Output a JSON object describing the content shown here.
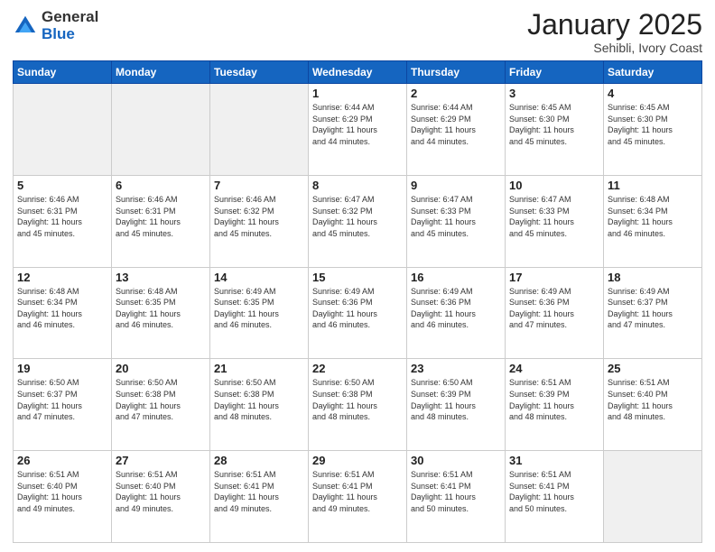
{
  "header": {
    "logo_general": "General",
    "logo_blue": "Blue",
    "month": "January 2025",
    "location": "Sehibli, Ivory Coast"
  },
  "weekdays": [
    "Sunday",
    "Monday",
    "Tuesday",
    "Wednesday",
    "Thursday",
    "Friday",
    "Saturday"
  ],
  "weeks": [
    [
      {
        "day": "",
        "info": ""
      },
      {
        "day": "",
        "info": ""
      },
      {
        "day": "",
        "info": ""
      },
      {
        "day": "1",
        "info": "Sunrise: 6:44 AM\nSunset: 6:29 PM\nDaylight: 11 hours\nand 44 minutes."
      },
      {
        "day": "2",
        "info": "Sunrise: 6:44 AM\nSunset: 6:29 PM\nDaylight: 11 hours\nand 44 minutes."
      },
      {
        "day": "3",
        "info": "Sunrise: 6:45 AM\nSunset: 6:30 PM\nDaylight: 11 hours\nand 45 minutes."
      },
      {
        "day": "4",
        "info": "Sunrise: 6:45 AM\nSunset: 6:30 PM\nDaylight: 11 hours\nand 45 minutes."
      }
    ],
    [
      {
        "day": "5",
        "info": "Sunrise: 6:46 AM\nSunset: 6:31 PM\nDaylight: 11 hours\nand 45 minutes."
      },
      {
        "day": "6",
        "info": "Sunrise: 6:46 AM\nSunset: 6:31 PM\nDaylight: 11 hours\nand 45 minutes."
      },
      {
        "day": "7",
        "info": "Sunrise: 6:46 AM\nSunset: 6:32 PM\nDaylight: 11 hours\nand 45 minutes."
      },
      {
        "day": "8",
        "info": "Sunrise: 6:47 AM\nSunset: 6:32 PM\nDaylight: 11 hours\nand 45 minutes."
      },
      {
        "day": "9",
        "info": "Sunrise: 6:47 AM\nSunset: 6:33 PM\nDaylight: 11 hours\nand 45 minutes."
      },
      {
        "day": "10",
        "info": "Sunrise: 6:47 AM\nSunset: 6:33 PM\nDaylight: 11 hours\nand 45 minutes."
      },
      {
        "day": "11",
        "info": "Sunrise: 6:48 AM\nSunset: 6:34 PM\nDaylight: 11 hours\nand 46 minutes."
      }
    ],
    [
      {
        "day": "12",
        "info": "Sunrise: 6:48 AM\nSunset: 6:34 PM\nDaylight: 11 hours\nand 46 minutes."
      },
      {
        "day": "13",
        "info": "Sunrise: 6:48 AM\nSunset: 6:35 PM\nDaylight: 11 hours\nand 46 minutes."
      },
      {
        "day": "14",
        "info": "Sunrise: 6:49 AM\nSunset: 6:35 PM\nDaylight: 11 hours\nand 46 minutes."
      },
      {
        "day": "15",
        "info": "Sunrise: 6:49 AM\nSunset: 6:36 PM\nDaylight: 11 hours\nand 46 minutes."
      },
      {
        "day": "16",
        "info": "Sunrise: 6:49 AM\nSunset: 6:36 PM\nDaylight: 11 hours\nand 46 minutes."
      },
      {
        "day": "17",
        "info": "Sunrise: 6:49 AM\nSunset: 6:36 PM\nDaylight: 11 hours\nand 47 minutes."
      },
      {
        "day": "18",
        "info": "Sunrise: 6:49 AM\nSunset: 6:37 PM\nDaylight: 11 hours\nand 47 minutes."
      }
    ],
    [
      {
        "day": "19",
        "info": "Sunrise: 6:50 AM\nSunset: 6:37 PM\nDaylight: 11 hours\nand 47 minutes."
      },
      {
        "day": "20",
        "info": "Sunrise: 6:50 AM\nSunset: 6:38 PM\nDaylight: 11 hours\nand 47 minutes."
      },
      {
        "day": "21",
        "info": "Sunrise: 6:50 AM\nSunset: 6:38 PM\nDaylight: 11 hours\nand 48 minutes."
      },
      {
        "day": "22",
        "info": "Sunrise: 6:50 AM\nSunset: 6:38 PM\nDaylight: 11 hours\nand 48 minutes."
      },
      {
        "day": "23",
        "info": "Sunrise: 6:50 AM\nSunset: 6:39 PM\nDaylight: 11 hours\nand 48 minutes."
      },
      {
        "day": "24",
        "info": "Sunrise: 6:51 AM\nSunset: 6:39 PM\nDaylight: 11 hours\nand 48 minutes."
      },
      {
        "day": "25",
        "info": "Sunrise: 6:51 AM\nSunset: 6:40 PM\nDaylight: 11 hours\nand 48 minutes."
      }
    ],
    [
      {
        "day": "26",
        "info": "Sunrise: 6:51 AM\nSunset: 6:40 PM\nDaylight: 11 hours\nand 49 minutes."
      },
      {
        "day": "27",
        "info": "Sunrise: 6:51 AM\nSunset: 6:40 PM\nDaylight: 11 hours\nand 49 minutes."
      },
      {
        "day": "28",
        "info": "Sunrise: 6:51 AM\nSunset: 6:41 PM\nDaylight: 11 hours\nand 49 minutes."
      },
      {
        "day": "29",
        "info": "Sunrise: 6:51 AM\nSunset: 6:41 PM\nDaylight: 11 hours\nand 49 minutes."
      },
      {
        "day": "30",
        "info": "Sunrise: 6:51 AM\nSunset: 6:41 PM\nDaylight: 11 hours\nand 50 minutes."
      },
      {
        "day": "31",
        "info": "Sunrise: 6:51 AM\nSunset: 6:41 PM\nDaylight: 11 hours\nand 50 minutes."
      },
      {
        "day": "",
        "info": ""
      }
    ]
  ]
}
